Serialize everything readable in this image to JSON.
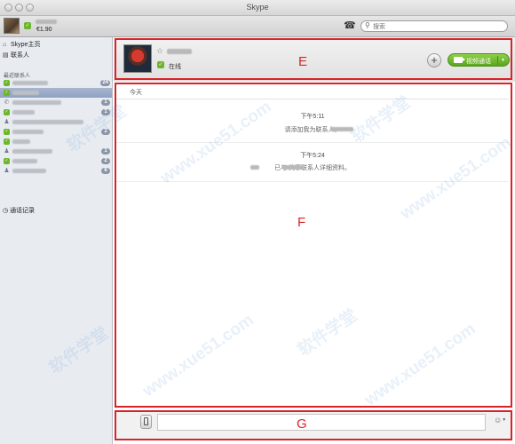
{
  "window": {
    "title": "Skype"
  },
  "account": {
    "credit": "€1.90"
  },
  "search": {
    "placeholder": "搜索"
  },
  "sidebar": {
    "nav": [
      {
        "label": "Skype主页",
        "icon": "home-icon"
      },
      {
        "label": "联系人",
        "icon": "address-book-icon"
      }
    ],
    "recent_label": "最近联系人",
    "contacts": [
      {
        "status": "online",
        "name_width": 40,
        "badge": "24",
        "selected": false
      },
      {
        "status": "online",
        "name_width": 30,
        "badge": "",
        "selected": true
      },
      {
        "status": "skype",
        "name_width": 55,
        "badge": "1",
        "selected": false
      },
      {
        "status": "online",
        "name_width": 25,
        "badge": "1",
        "selected": false
      },
      {
        "status": "group",
        "name_width": 80,
        "badge": "",
        "selected": false
      },
      {
        "status": "online",
        "name_width": 35,
        "badge": "2",
        "selected": false
      },
      {
        "status": "online",
        "name_width": 20,
        "badge": "",
        "selected": false
      },
      {
        "status": "group",
        "name_width": 45,
        "badge": "1",
        "selected": false
      },
      {
        "status": "online",
        "name_width": 28,
        "badge": "2",
        "selected": false
      },
      {
        "status": "group",
        "name_width": 38,
        "badge": "6",
        "selected": false
      }
    ],
    "history_label": "通话记录"
  },
  "conversation": {
    "status_text": "在线",
    "video_call_label": "视频通话",
    "today_label": "今天",
    "messages": [
      {
        "time": "下午5:11",
        "text": "请添加我为联系人。"
      },
      {
        "time": "下午5:24",
        "text": "已与 共享联系人详细资料。"
      }
    ]
  },
  "annotations": {
    "e": "E",
    "f": "F",
    "g": "G"
  },
  "colors": {
    "annotation_red": "#d8232a",
    "online_green": "#6bb62a",
    "video_green": "#5aa51d",
    "selection_blue": "#8ea1c3"
  }
}
